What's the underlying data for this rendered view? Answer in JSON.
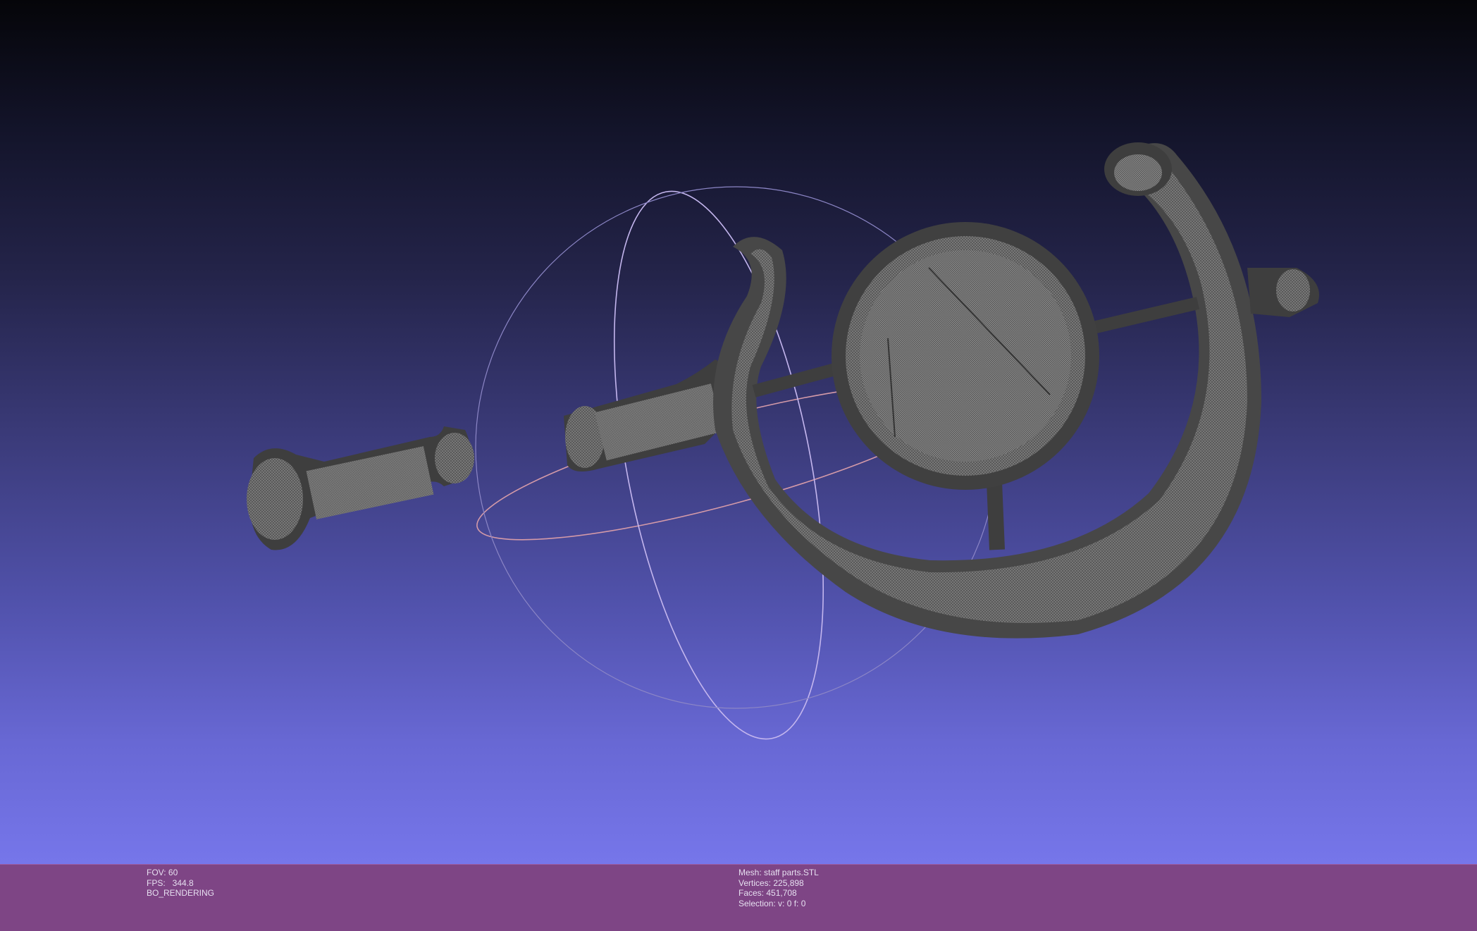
{
  "viewer": {
    "mesh_wireframe_color": "#6b6b6b",
    "mesh_dark_color": "#3f3f3f",
    "background_top": "#050509",
    "background_bottom": "#7676ea",
    "status_bar_color": "#7e4585"
  },
  "status": {
    "fov": "FOV: 60",
    "fps": "FPS:   344.8",
    "render_mode": "BO_RENDERING",
    "mesh": "Mesh: staff parts.STL",
    "vertices": "Vertices: 225,898",
    "faces": "Faces: 451,708",
    "selection": "Selection: v: 0 f: 0"
  }
}
